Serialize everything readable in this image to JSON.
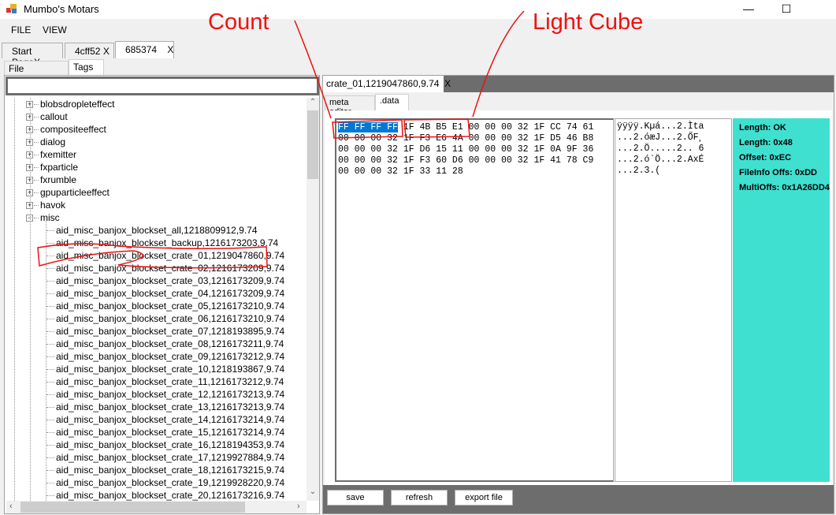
{
  "window": {
    "title": "Mumbo's Motars"
  },
  "menu": [
    "FILE",
    "VIEW"
  ],
  "doc_tabs": [
    {
      "label": "Start PageX"
    },
    {
      "label": "4cff52",
      "close": "X"
    },
    {
      "label": "685374",
      "close": "X"
    }
  ],
  "left_tabs": [
    "File Information",
    "Tags"
  ],
  "search": {
    "value": ""
  },
  "tree": {
    "top": [
      "blobsdropleteffect",
      "callout",
      "compositeeffect",
      "dialog",
      "fxemitter",
      "fxparticle",
      "fxrumble",
      "gpuparticleeffect",
      "havok",
      "misc"
    ],
    "misc_children": [
      "aid_misc_banjox_blockset_all,1218809912,9.74",
      "aid_misc_banjox_blockset_backup,1216173203,9.74",
      "aid_misc_banjox_blockset_crate_01,1219047860,9.74",
      "aid_misc_banjox_blockset_crate_02,1216173209,9.74",
      "aid_misc_banjox_blockset_crate_03,1216173209,9.74",
      "aid_misc_banjox_blockset_crate_04,1216173209,9.74",
      "aid_misc_banjox_blockset_crate_05,1216173210,9.74",
      "aid_misc_banjox_blockset_crate_06,1216173210,9.74",
      "aid_misc_banjox_blockset_crate_07,1218193895,9.74",
      "aid_misc_banjox_blockset_crate_08,1216173211,9.74",
      "aid_misc_banjox_blockset_crate_09,1216173212,9.74",
      "aid_misc_banjox_blockset_crate_10,1218193867,9.74",
      "aid_misc_banjox_blockset_crate_11,1216173212,9.74",
      "aid_misc_banjox_blockset_crate_12,1216173213,9.74",
      "aid_misc_banjox_blockset_crate_13,1216173213,9.74",
      "aid_misc_banjox_blockset_crate_14,1216173214,9.74",
      "aid_misc_banjox_blockset_crate_15,1216173214,9.74",
      "aid_misc_banjox_blockset_crate_16,1218194353,9.74",
      "aid_misc_banjox_blockset_crate_17,1219927884,9.74",
      "aid_misc_banjox_blockset_crate_18,1216173215,9.74",
      "aid_misc_banjox_blockset_crate_19,1219928220,9.74",
      "aid_misc_banjox_blockset_crate_20,1216173216,9.74"
    ]
  },
  "editor": {
    "file_tab": "crate_01,1219047860,9.74",
    "file_tab_close": "X",
    "tabs": [
      "meta editor",
      ".data"
    ],
    "hex_selected": "FF FF FF FF",
    "hex_first_rest": " 1F 4B B5 E1 00 00 00 32 1F CC 74 61",
    "hex_lines": [
      "00 00 00 32 1F F3 E6 4A 00 00 00 32 1F D5 46 B8",
      "00 00 00 32 1F D6 15 11 00 00 00 32 1F 0A 9F 36",
      "00 00 00 32 1F F3 60 D6 00 00 00 32 1F 41 78 C9",
      "00 00 00 32 1F 33 11 28"
    ],
    "ascii_lines": [
      "ÿÿÿÿ.Kµá...2.Ìta",
      "...2.óæJ...2.ŐF¸",
      "...2.Ö.....2.. 6",
      "...2.ó`Ö...2.AxÉ",
      "...2.3.("
    ],
    "info": [
      "Length: OK",
      "Length: 0x48",
      "Offset: 0xEC",
      "FileInfo Offs: 0xDD",
      "MultiOffs: 0x1A26DD40"
    ],
    "info_color": "#40e0d0",
    "buttons": [
      "save",
      "refresh",
      "export file"
    ]
  },
  "annotations": {
    "count": "Count",
    "light_cube": "Light Cube",
    "color": "#ee1111"
  }
}
